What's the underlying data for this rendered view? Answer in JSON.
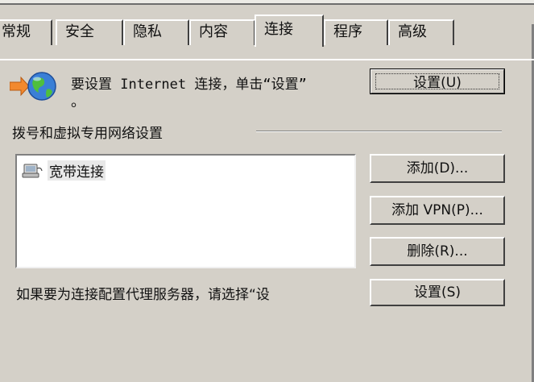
{
  "tabs": [
    {
      "label": "常规",
      "active": false
    },
    {
      "label": "安全",
      "active": false
    },
    {
      "label": "隐私",
      "active": false
    },
    {
      "label": "内容",
      "active": false
    },
    {
      "label": "连接",
      "active": true
    },
    {
      "label": "程序",
      "active": false
    },
    {
      "label": "高级",
      "active": false
    }
  ],
  "setup": {
    "text": "要设置 Internet 连接，单击“设置”",
    "text_cont": "。",
    "button_label": "设置(U)",
    "icon": "internet-connection-wizard-icon"
  },
  "dialup": {
    "heading": "拨号和虚拟专用网络设置",
    "items": [
      {
        "label": "宽带连接",
        "icon": "broadband-connection-icon"
      }
    ],
    "add_button": "添加(D)...",
    "add_vpn_button": "添加 VPN(P)...",
    "remove_button": "删除(R)...",
    "proxy_text": "如果要为连接配置代理服务器，请选择“设",
    "settings_button": "设置(S)"
  }
}
